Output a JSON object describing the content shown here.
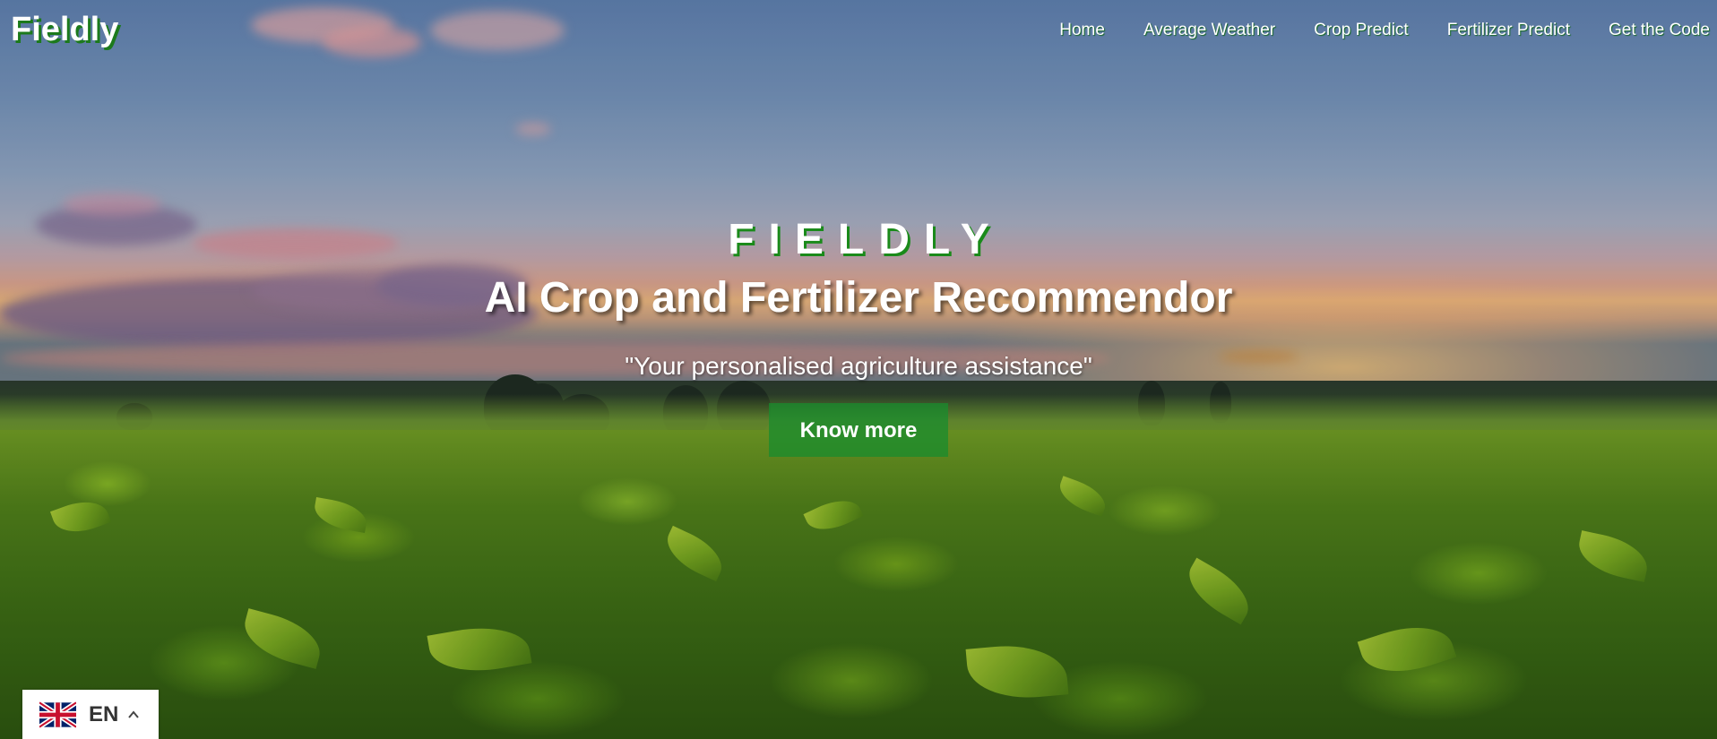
{
  "navbar": {
    "brand": "Fieldly",
    "links": [
      {
        "label": "Home"
      },
      {
        "label": "Average Weather"
      },
      {
        "label": "Crop Predict"
      },
      {
        "label": "Fertilizer Predict"
      },
      {
        "label": "Get the Code"
      }
    ]
  },
  "hero": {
    "kicker": "FIELDLY",
    "title": "AI Crop and Fertilizer Recommendor",
    "subtitle": "\"Your personalised agriculture assistance\"",
    "button_label": "Know more"
  },
  "language": {
    "code": "EN",
    "flag_icon": "uk-flag-icon",
    "caret_icon": "chevron-up-icon"
  },
  "colors": {
    "accent_green": "#1a8a1a",
    "button_green": "#188c2d",
    "text_white": "#ffffff"
  }
}
